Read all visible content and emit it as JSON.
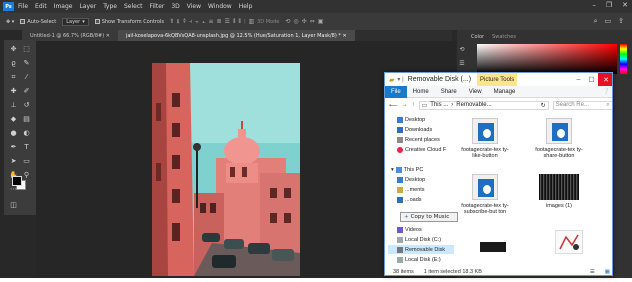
{
  "photoshop": {
    "logo": "Ps",
    "menu": [
      "File",
      "Edit",
      "Image",
      "Layer",
      "Type",
      "Select",
      "Filter",
      "3D",
      "View",
      "Window",
      "Help"
    ],
    "options": {
      "auto_select": "Auto-Select",
      "layer_dropdown": "Layer",
      "show_transform": "Show Transform Controls",
      "mode_3d": "3D Mode"
    },
    "tabs": [
      {
        "label": "Untitled-1 @ 66.7% (RGB/8#)"
      },
      {
        "label": "jail-koselapova-6kQBVsQA8-unsplash.jpg @ 12.5% (Hue/Saturation 1, Layer Mask/8) *"
      }
    ],
    "panel_tabs": [
      "Color",
      "Swatches"
    ],
    "colors": {
      "accent": "#1e7bd8",
      "bg": "#282828"
    }
  },
  "explorer": {
    "title": "Removable Disk (...)",
    "context_tab": "Picture Tools",
    "ribbon_tabs": [
      "File",
      "Home",
      "Share",
      "View",
      "Manage"
    ],
    "address": [
      "This ...",
      "Removable..."
    ],
    "search_placeholder": "Search Re...",
    "nav": [
      {
        "label": "Desktop",
        "icon": "desktop-icon"
      },
      {
        "label": "Downloads",
        "icon": "downloads-icon"
      },
      {
        "label": "Recent places",
        "icon": "recent-places-icon"
      },
      {
        "label": "Creative Cloud F",
        "icon": "creative-cloud-icon"
      },
      {
        "label": "This PC",
        "icon": "this-pc-icon"
      },
      {
        "label": "Desktop",
        "icon": "desktop-icon"
      },
      {
        "label": "...ments",
        "icon": "documents-icon"
      },
      {
        "label": "...oads",
        "icon": "downloads-icon"
      },
      {
        "label": "Videos",
        "icon": "videos-icon"
      },
      {
        "label": "Local Disk (C:)",
        "icon": "drive-icon"
      },
      {
        "label": "Removable Disk",
        "icon": "removable-disk-icon"
      },
      {
        "label": "Local Disk (E:)",
        "icon": "drive-icon"
      }
    ],
    "files": [
      {
        "name": "footagecrate-tex ty-like-button",
        "thumb": "video"
      },
      {
        "name": "footagecrate-tex ty-share-button",
        "thumb": "video"
      },
      {
        "name": "footagecrate-tex ty-subscribe-but ton",
        "thumb": "video"
      },
      {
        "name": "images (1)",
        "thumb": "dark"
      },
      {
        "name": "",
        "thumb": "dark"
      },
      {
        "name": "",
        "thumb": "sketch"
      }
    ],
    "drag_tooltip": "Copy to Music",
    "status_count": "38 items",
    "status_selection": "1 item selected  18.3 KB"
  }
}
